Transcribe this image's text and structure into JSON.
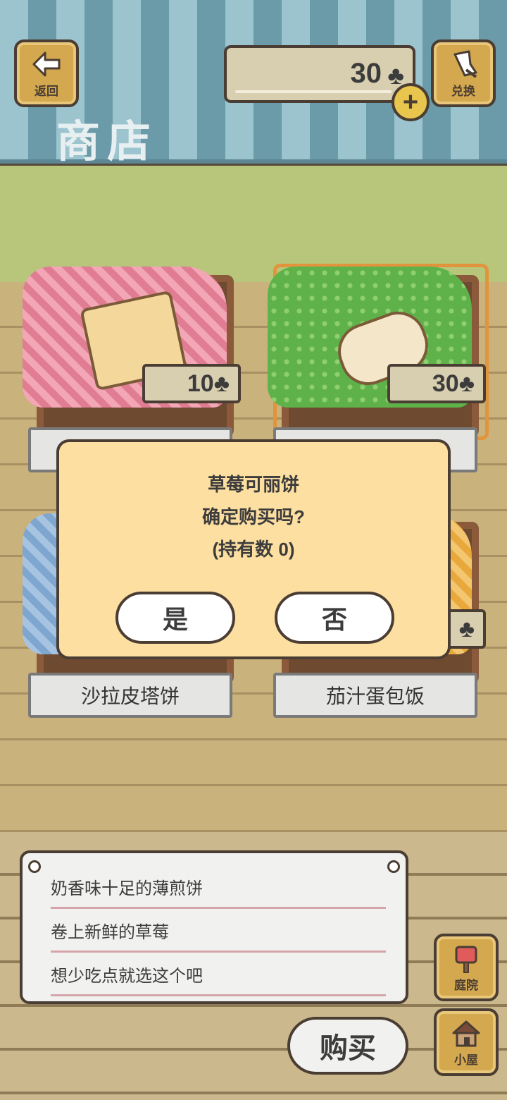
{
  "header": {
    "back_label": "返回",
    "exchange_label": "兑换",
    "title": "商店",
    "currency_value": "30",
    "currency_icon": "clover-icon",
    "add_icon": "plus-icon"
  },
  "items": [
    {
      "price": "10",
      "name": "",
      "cloth": "pink"
    },
    {
      "price": "30",
      "name": "",
      "cloth": "green",
      "selected": true
    },
    {
      "price": "",
      "name": "沙拉皮塔饼",
      "cloth": "blue"
    },
    {
      "price": "",
      "name": "茄汁蛋包饭",
      "cloth": "yellow"
    }
  ],
  "dialog": {
    "item_name": "草莓可丽饼",
    "question": "确定购买吗?",
    "owned": "(持有数 0)",
    "yes_label": "是",
    "no_label": "否"
  },
  "description": {
    "lines": [
      "奶香味十足的薄煎饼",
      "卷上新鲜的草莓",
      "想少吃点就选这个吧"
    ]
  },
  "nav": {
    "yard_label": "庭院",
    "house_label": "小屋",
    "buy_label": "购买"
  },
  "colors": {
    "accent": "#e2943d",
    "dialog_bg": "#fddfa1",
    "outline": "#4a3d33"
  }
}
